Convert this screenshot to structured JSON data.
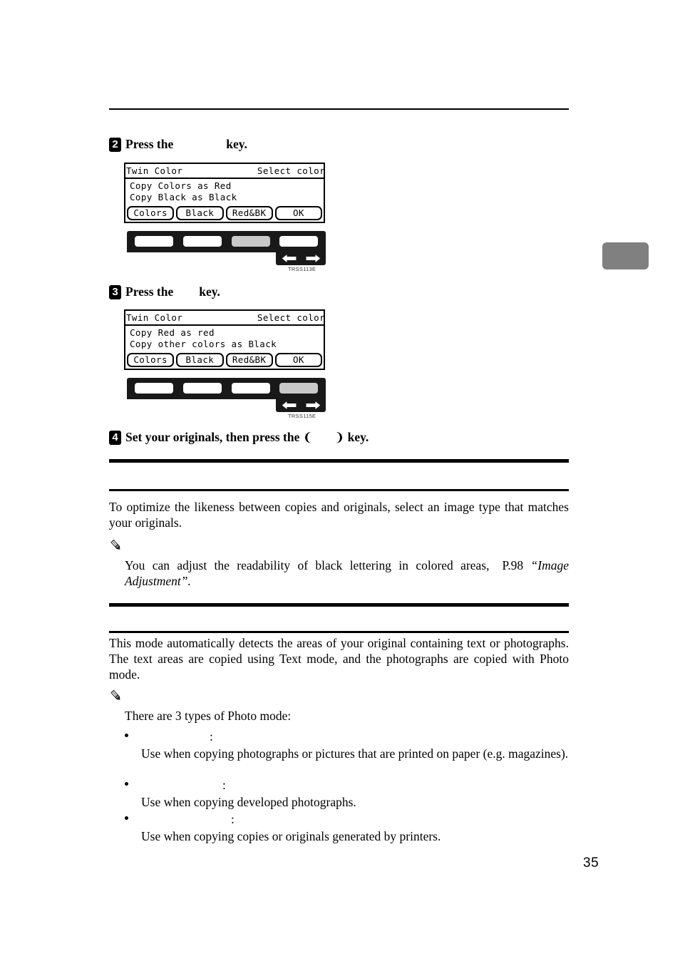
{
  "document": {
    "page_number": "35"
  },
  "steps": [
    {
      "number": "2",
      "text_before": "Press the",
      "text_after": "key."
    },
    {
      "number": "3",
      "text_before": "Press the",
      "text_after": "key."
    },
    {
      "number": "4",
      "text_before": "Set your originals, then press the",
      "bracket_open": "❨",
      "bracket_close": "❩",
      "text_after": "key."
    }
  ],
  "lcd_screens": [
    {
      "title_left": "Twin Color",
      "title_right": "Select color",
      "lines": [
        "Copy Colors as Red",
        "Copy Black as Black"
      ],
      "buttons": [
        "Colors",
        "Black",
        "Red&BK",
        "OK"
      ]
    },
    {
      "title_left": "Twin Color",
      "title_right": "Select color",
      "lines": [
        "Copy Red as red",
        "Copy other colors as Black"
      ],
      "buttons": [
        "Colors",
        "Black",
        "Red&BK",
        "OK"
      ]
    }
  ],
  "keypads": [
    {
      "caption": "TRSS113E",
      "selected_key_index": 3,
      "keys": [
        "key-1",
        "key-2",
        "key-3",
        "key-4"
      ],
      "arrows": [
        "left-arrow-key",
        "right-arrow-key"
      ]
    },
    {
      "caption": "TRSS115E",
      "selected_key_index": 4,
      "keys": [
        "key-1",
        "key-2",
        "key-3",
        "key-4"
      ],
      "arrows": [
        "left-arrow-key",
        "right-arrow-key"
      ]
    }
  ],
  "sections": [
    {
      "heading": "",
      "paragraph": "To optimize the likeness between copies and originals, select an image type that matches your originals.",
      "note": {
        "icon": "pencil-note-icon",
        "text_before": "You can adjust the readability of black lettering in colored areas,",
        "reference_page": "P.98",
        "reference_title": "“Image Adjustment”."
      }
    },
    {
      "heading": "",
      "paragraph": "This mode automatically detects the areas of your original containing text or photographs. The text areas are copied using Text mode, and the photographs are copied with Photo mode.",
      "note": {
        "icon": "pencil-note-icon",
        "intro": "There are 3 types of Photo mode:",
        "bullets": [
          {
            "term": "",
            "colon": ":",
            "description": "Use when copying photographs or pictures that are printed on paper (e.g. magazines)."
          },
          {
            "term": "",
            "colon": ":",
            "description": "Use when copying developed photographs."
          },
          {
            "term": "",
            "colon": ":",
            "description": "Use when copying copies or originals generated by printers."
          }
        ]
      }
    }
  ],
  "side_tab": {
    "label": "",
    "color": "#808080"
  }
}
